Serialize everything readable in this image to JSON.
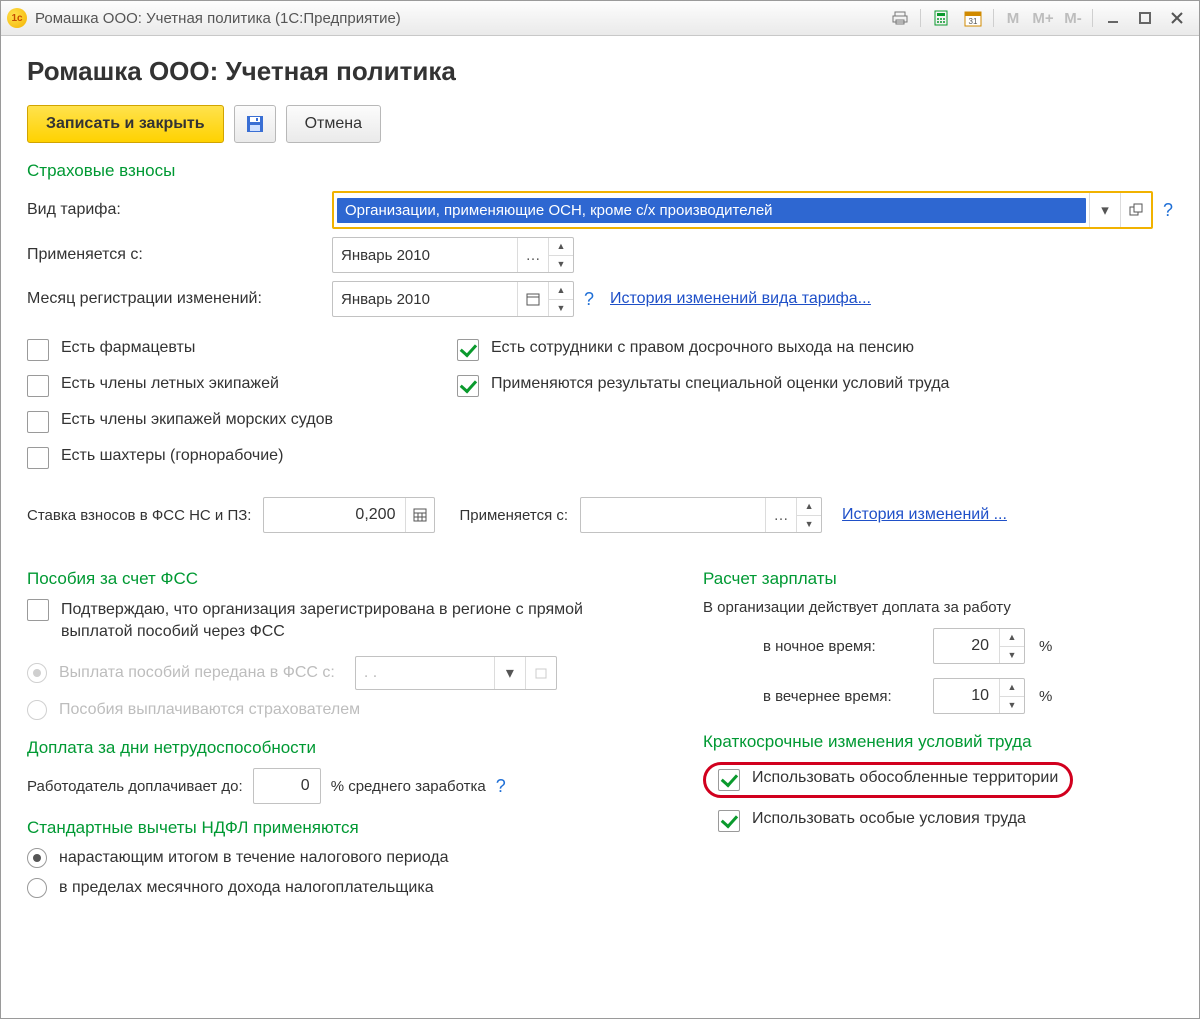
{
  "window": {
    "title": "Ромашка ООО: Учетная политика  (1С:Предприятие)"
  },
  "page": {
    "heading": "Ромашка ООО: Учетная политика"
  },
  "toolbar": {
    "save_close": "Записать и закрыть",
    "cancel": "Отмена"
  },
  "insurance": {
    "title": "Страховые взносы",
    "tariff_label": "Вид тарифа:",
    "tariff_value": "Организации, применяющие ОСН, кроме с/х производителей",
    "applies_from_label": "Применяется с:",
    "applies_from_value": "Январь 2010",
    "reg_month_label": "Месяц регистрации изменений:",
    "reg_month_value": "Январь 2010",
    "history_link": "История изменений вида тарифа...",
    "checks": {
      "pharma": "Есть фармацевты",
      "flight": "Есть члены летных экипажей",
      "ships": "Есть члены экипажей морских судов",
      "miners": "Есть шахтеры (горнорабочие)",
      "early_pension": "Есть сотрудники с правом досрочного выхода на пенсию",
      "special_eval": "Применяются результаты специальной оценки условий труда"
    },
    "fss_rate_label": "Ставка взносов в ФСС НС и ПЗ:",
    "fss_rate_value": "0,200",
    "fss_applies_from_label": "Применяется с:",
    "fss_applies_from_value": "",
    "fss_history_link": "История изменений ..."
  },
  "fss_block": {
    "title": "Пособия за счет ФСС",
    "confirm": "Подтверждаю, что организация зарегистрирована в регионе с прямой выплатой пособий через ФСС",
    "radio_fss": "Выплата пособий передана в ФСС с:",
    "radio_fss_date": ". .",
    "radio_insurer": "Пособия выплачиваются страхователем"
  },
  "disability": {
    "title": "Доплата за дни нетрудоспособности",
    "label": "Работодатель доплачивает до:",
    "value": "0",
    "suffix": "% среднего заработка"
  },
  "ndfl": {
    "title": "Стандартные вычеты НДФЛ применяются",
    "r1": "нарастающим итогом в течение налогового периода",
    "r2": "в пределах месячного дохода налогоплательщика"
  },
  "salary": {
    "title": "Расчет зарплаты",
    "desc": "В организации действует доплата за работу",
    "night_label": "в ночное время:",
    "night_value": "20",
    "evening_label": "в вечернее время:",
    "evening_value": "10",
    "pct": "%"
  },
  "short_term": {
    "title": "Краткосрочные изменения условий труда",
    "cb1": "Использовать обособленные территории",
    "cb2": "Использовать особые условия труда"
  }
}
